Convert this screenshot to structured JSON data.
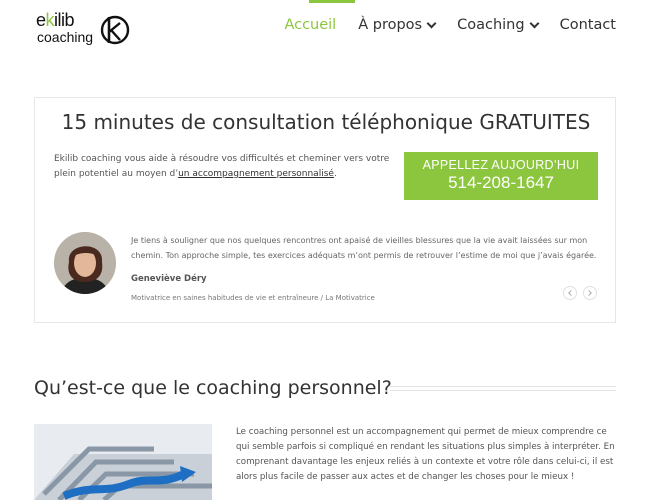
{
  "logo": {
    "word1_prefix": "e",
    "word1_accent": "k",
    "word1_suffix": "ilib",
    "word2": "coaching"
  },
  "nav": [
    {
      "label": "Accueil",
      "active": true
    },
    {
      "label": "À propos",
      "dropdown": true
    },
    {
      "label": "Coaching",
      "dropdown": true
    },
    {
      "label": "Contact"
    }
  ],
  "promo": {
    "title": "15 minutes de consultation téléphonique GRATUITES",
    "text_before": "Ekilib coaching vous aide à résoudre vos difficultés et cheminer vers votre plein potentiel au moyen d’",
    "text_link": "un accompagnement personnalisé",
    "text_after": ".",
    "cta_line1": "APPELLEZ AUJOURD’HUI",
    "cta_line2": "514-208-1647"
  },
  "testimonial": {
    "quote": "Je tiens à souligner que nos quelques rencontres ont apaisé de vieilles blessures que la vie avait laissées sur mon chemin. Ton approche simple, tes exercices adéquats m’ont permis de retrouver l’estime de moi que j’avais égarée.",
    "name": "Geneviève Déry",
    "role": "Motivatrice en saines habitudes de vie et entraîneure / La Motivatrice"
  },
  "section": {
    "title": "Qu’est-ce que le coaching personnel?",
    "paragraph": "Le coaching personnel est un accompagnement qui permet de mieux comprendre ce qui semble parfois si compliqué en rendant les situations plus simples à interpréter. En comprenant davantage les enjeux reliés à un contexte et votre rôle dans celui-ci, il est alors plus facile de passer aux actes et de changer les choses pour le mieux !"
  },
  "colors": {
    "accent": "#8cc63e",
    "text": "#333333"
  }
}
